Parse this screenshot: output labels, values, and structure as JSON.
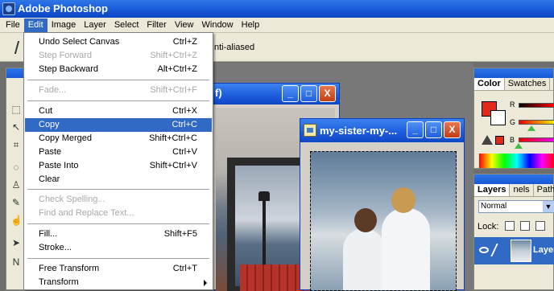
{
  "app": {
    "title": "Adobe Photoshop"
  },
  "menubar": [
    "File",
    "Edit",
    "Image",
    "Layer",
    "Select",
    "Filter",
    "View",
    "Window",
    "Help"
  ],
  "menubar_active": "Edit",
  "options_bar": {
    "anti_aliased_label": "Anti-aliased"
  },
  "edit_menu": {
    "items": [
      {
        "label": "Undo Select Canvas",
        "shortcut": "Ctrl+Z",
        "disabled": false
      },
      {
        "label": "Step Forward",
        "shortcut": "Shift+Ctrl+Z",
        "disabled": true
      },
      {
        "label": "Step Backward",
        "shortcut": "Alt+Ctrl+Z",
        "disabled": false
      },
      {
        "label": "Fade...",
        "shortcut": "Shift+Ctrl+F",
        "disabled": true
      },
      {
        "label": "Cut",
        "shortcut": "Ctrl+X",
        "disabled": false
      },
      {
        "label": "Copy",
        "shortcut": "Ctrl+C",
        "disabled": false,
        "highlighted": true
      },
      {
        "label": "Copy Merged",
        "shortcut": "Shift+Ctrl+C",
        "disabled": false
      },
      {
        "label": "Paste",
        "shortcut": "Ctrl+V",
        "disabled": false
      },
      {
        "label": "Paste Into",
        "shortcut": "Shift+Ctrl+V",
        "disabled": false
      },
      {
        "label": "Clear",
        "shortcut": "",
        "disabled": false
      },
      {
        "label": "Check Spelling...",
        "shortcut": "",
        "disabled": true
      },
      {
        "label": "Find and Replace Text...",
        "shortcut": "",
        "disabled": true
      },
      {
        "label": "Fill...",
        "shortcut": "Shift+F5",
        "disabled": false
      },
      {
        "label": "Stroke...",
        "shortcut": "",
        "disabled": false
      },
      {
        "label": "Free Transform",
        "shortcut": "Ctrl+T",
        "disabled": false
      },
      {
        "label": "Transform",
        "shortcut": "",
        "disabled": false,
        "submenu": true
      }
    ]
  },
  "windows": {
    "back": {
      "title": "f)"
    },
    "front": {
      "title": "my-sister-my-..."
    },
    "buttons": {
      "minimize": "_",
      "maximize": "□",
      "close": "X"
    }
  },
  "color_palette": {
    "tabs": [
      "Color",
      "Swatches"
    ],
    "channel_labels": [
      "R",
      "G",
      "B"
    ],
    "foreground_color": "#e1291a",
    "background_color": "#ffffff"
  },
  "layers_palette": {
    "tabs": [
      "Layers",
      "Channels",
      "Paths"
    ],
    "tab_visible_labels": [
      "Layers",
      "nels",
      "Path"
    ],
    "blend_mode": "Normal",
    "lock_label": "Lock:",
    "layer_name": "Layer"
  },
  "icons": {
    "toolbox": [
      "marquee-icon",
      "move-icon",
      "crop-icon",
      "lasso-icon",
      "stamp-icon",
      "brush-icon",
      "smudge-icon",
      "path-select-icon",
      "pen-icon"
    ]
  }
}
